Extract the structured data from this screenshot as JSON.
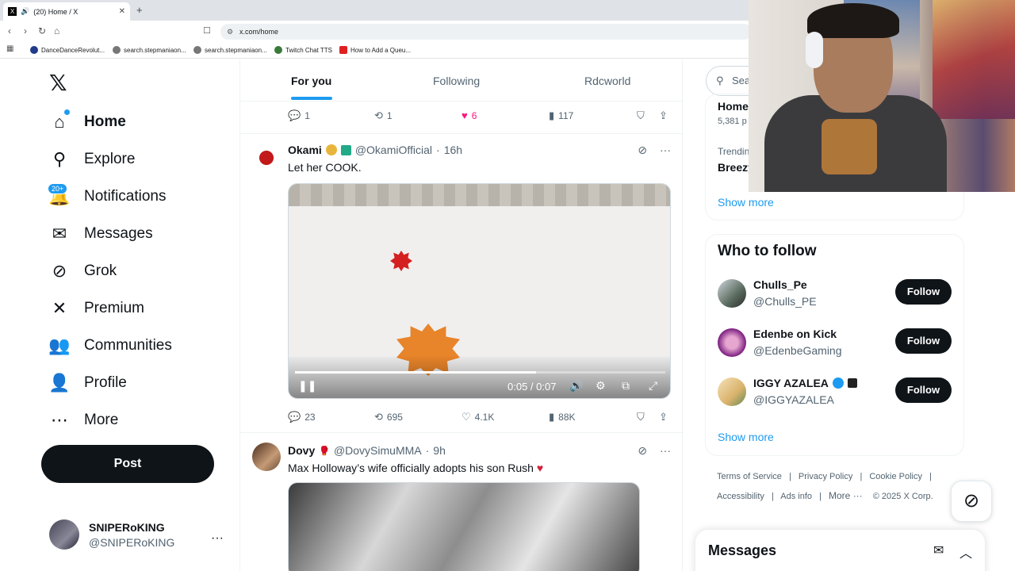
{
  "browser": {
    "tab_title": "(20) Home / X",
    "url": "x.com/home",
    "bookmarks": [
      "DanceDanceRevolut...",
      "search.stepmaniaon...",
      "search.stepmaniaon...",
      "Twitch Chat TTS",
      "How to Add a Queu..."
    ]
  },
  "nav": {
    "items": [
      {
        "label": "Home",
        "icon": "home-icon"
      },
      {
        "label": "Explore",
        "icon": "search-icon"
      },
      {
        "label": "Notifications",
        "icon": "bell-icon"
      },
      {
        "label": "Messages",
        "icon": "mail-icon"
      },
      {
        "label": "Grok",
        "icon": "grok-icon"
      },
      {
        "label": "Premium",
        "icon": "x-icon"
      },
      {
        "label": "Communities",
        "icon": "people-icon"
      },
      {
        "label": "Profile",
        "icon": "person-icon"
      },
      {
        "label": "More",
        "icon": "more-circle-icon"
      }
    ],
    "notifications_badge": "20+",
    "post_label": "Post",
    "user_name": "SNIPERoKING",
    "user_handle": "@SNIPERoKING"
  },
  "timeline": {
    "tabs": [
      "For you",
      "Following",
      "Rdcworld"
    ],
    "prev_post_actions": {
      "replies": "1",
      "reposts": "1",
      "likes": "6",
      "views": "117"
    },
    "post1": {
      "name": "Okami",
      "handle": "@OkamiOfficial",
      "time": "16h",
      "text": "Let her COOK.",
      "video_time": "0:05 / 0:07",
      "video_progress": 0.65,
      "replies": "23",
      "reposts": "695",
      "likes": "4.1K",
      "views": "88K"
    },
    "post2": {
      "name": "Dovy",
      "handle": "@DovySimuMMA",
      "time": "9h",
      "text": "Max Holloway’s wife officially adopts his son Rush"
    }
  },
  "sidebar": {
    "search_placeholder": "Sear",
    "trend_title": "Home",
    "trend_sub": "5,381 p",
    "trend_cat": "Trendin",
    "trend_name": "Breezy",
    "show_more": "Show more",
    "who_to_follow": "Who to follow",
    "follow_label": "Follow",
    "suggestions": [
      {
        "name": "Chulls_Pe",
        "handle": "@Chulls_PE"
      },
      {
        "name": "Edenbe on Kick",
        "handle": "@EdenbeGaming"
      },
      {
        "name": "IGGY AZALEA",
        "handle": "@IGGYAZALEA"
      }
    ],
    "footer": {
      "terms": "Terms of Service",
      "privacy": "Privacy Policy",
      "cookie": "Cookie Policy",
      "accessibility": "Accessibility",
      "ads": "Ads info",
      "more": "More ···",
      "copyright": "© 2025 X Corp."
    },
    "messages_title": "Messages"
  }
}
